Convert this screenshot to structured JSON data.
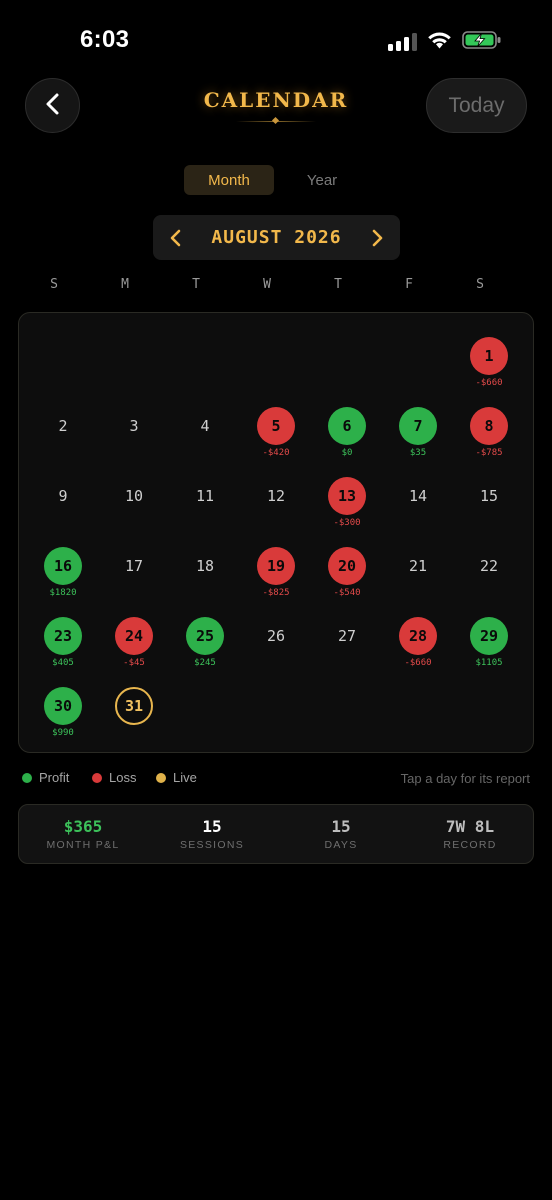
{
  "status_bar": {
    "time": "6:03"
  },
  "header": {
    "title": "CALENDAR",
    "today_label": "Today"
  },
  "view_toggle": {
    "month_label": "Month",
    "year_label": "Year",
    "selected": "Month"
  },
  "month_nav": {
    "label": "AUGUST 2026"
  },
  "weekdays": [
    "S",
    "M",
    "T",
    "W",
    "T",
    "F",
    "S"
  ],
  "calendar": {
    "first_weekday_index": 6,
    "days": [
      {
        "day": "1",
        "status": "loss",
        "amount": "-$660"
      },
      {
        "day": "2",
        "status": "none",
        "amount": ""
      },
      {
        "day": "3",
        "status": "none",
        "amount": ""
      },
      {
        "day": "4",
        "status": "none",
        "amount": ""
      },
      {
        "day": "5",
        "status": "loss",
        "amount": "-$420"
      },
      {
        "day": "6",
        "status": "profit",
        "amount": "$0"
      },
      {
        "day": "7",
        "status": "profit",
        "amount": "$35"
      },
      {
        "day": "8",
        "status": "loss",
        "amount": "-$785"
      },
      {
        "day": "9",
        "status": "none",
        "amount": ""
      },
      {
        "day": "10",
        "status": "none",
        "amount": ""
      },
      {
        "day": "11",
        "status": "none",
        "amount": ""
      },
      {
        "day": "12",
        "status": "none",
        "amount": ""
      },
      {
        "day": "13",
        "status": "loss",
        "amount": "-$300"
      },
      {
        "day": "14",
        "status": "none",
        "amount": ""
      },
      {
        "day": "15",
        "status": "none",
        "amount": ""
      },
      {
        "day": "16",
        "status": "profit",
        "amount": "$1820"
      },
      {
        "day": "17",
        "status": "none",
        "amount": ""
      },
      {
        "day": "18",
        "status": "none",
        "amount": ""
      },
      {
        "day": "19",
        "status": "loss",
        "amount": "-$825"
      },
      {
        "day": "20",
        "status": "loss",
        "amount": "-$540"
      },
      {
        "day": "21",
        "status": "none",
        "amount": ""
      },
      {
        "day": "22",
        "status": "none",
        "amount": ""
      },
      {
        "day": "23",
        "status": "profit",
        "amount": "$405"
      },
      {
        "day": "24",
        "status": "loss",
        "amount": "-$45"
      },
      {
        "day": "25",
        "status": "profit",
        "amount": "$245"
      },
      {
        "day": "26",
        "status": "none",
        "amount": ""
      },
      {
        "day": "27",
        "status": "none",
        "amount": ""
      },
      {
        "day": "28",
        "status": "loss",
        "amount": "-$660"
      },
      {
        "day": "29",
        "status": "profit",
        "amount": "$1105"
      },
      {
        "day": "30",
        "status": "profit",
        "amount": "$990"
      },
      {
        "day": "31",
        "status": "live",
        "amount": ""
      }
    ]
  },
  "legend": {
    "items": [
      {
        "label": "Profit",
        "color": "#2db04a"
      },
      {
        "label": "Loss",
        "color": "#d93a3a"
      },
      {
        "label": "Live",
        "color": "#e0b24a"
      }
    ],
    "hint": "Tap a day for its report"
  },
  "summary": {
    "stats": [
      {
        "value": "$365",
        "label": "MONTH P&L",
        "color": "#3cc15a"
      },
      {
        "value": "15",
        "label": "SESSIONS",
        "color": "#ffffff"
      },
      {
        "value": "15",
        "label": "DAYS",
        "color": "#bdbdbd"
      },
      {
        "value": "7W 8L",
        "label": "RECORD",
        "color": "#bdbdbd"
      }
    ]
  },
  "colors": {
    "accent_gold": "#f2b84b",
    "profit": "#2db04a",
    "loss": "#d93a3a",
    "live": "#e8b64e",
    "background": "#000000"
  }
}
